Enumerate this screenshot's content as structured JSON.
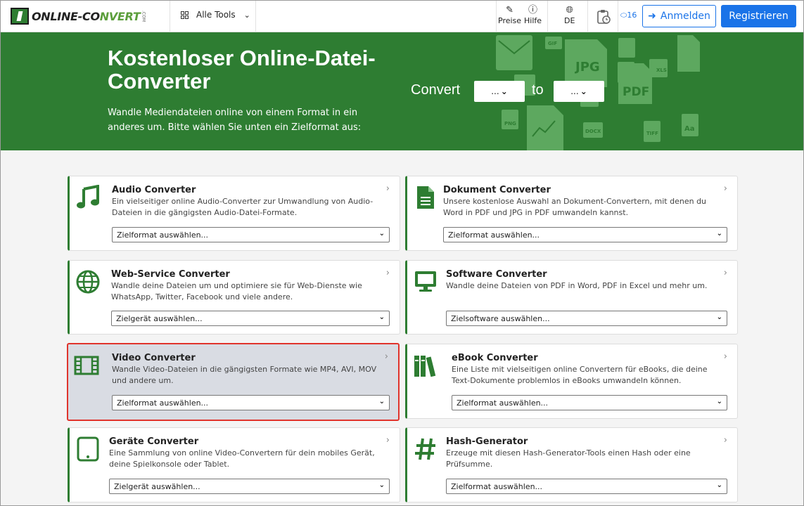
{
  "nav": {
    "logo_main": "ONLINE-CO",
    "logo_accent": "NVERT",
    "logo_suffix": ".COM",
    "all_tools": "Alle Tools",
    "prices": "Preise",
    "help": "Hilfe",
    "language": "DE",
    "tokens": "16",
    "login": "Anmelden",
    "register": "Registrieren"
  },
  "hero": {
    "title": "Kostenloser Online-Datei-Converter",
    "subtitle": "Wandle Mediendateien online von einem Format in ein anderes um. Bitte wählen Sie unten ein Zielformat aus:",
    "convert_label": "Convert",
    "to_label": "to",
    "from_value": "...",
    "to_value": "...",
    "deco_labels": [
      "GIF",
      "JPG",
      "XLS",
      "PDF",
      "PNG",
      "DOCX",
      "TIFF",
      "Aa"
    ]
  },
  "cards": [
    {
      "title": "Audio Converter",
      "desc": "Ein vielseitiger online Audio-Converter zur Umwandlung von Audio-Dateien in die gängigsten Audio-Datei-Formate.",
      "select": "Zielformat auswählen...",
      "icon": "music-note-icon"
    },
    {
      "title": "Dokument Converter",
      "desc": "Unsere kostenlose Auswahl an Dokument-Convertern, mit denen du Word in PDF und JPG in PDF umwandeln kannst.",
      "select": "Zielformat auswählen...",
      "icon": "document-icon"
    },
    {
      "title": "Web-Service Converter",
      "desc": "Wandle deine Dateien um und optimiere sie für Web-Dienste wie WhatsApp, Twitter, Facebook und viele andere.",
      "select": "Zielgerät auswählen...",
      "icon": "globe-icon"
    },
    {
      "title": "Software Converter",
      "desc": "Wandle deine Dateien von PDF in Word, PDF in Excel und mehr um.",
      "select": "Zielsoftware auswählen...",
      "icon": "monitor-icon"
    },
    {
      "title": "Video Converter",
      "desc": "Wandle Video-Dateien in die gängigsten Formate wie MP4, AVI, MOV und andere um.",
      "select": "Zielformat auswählen...",
      "icon": "film-icon"
    },
    {
      "title": "eBook Converter",
      "desc": "Eine Liste mit vielseitigen online Convertern für eBooks, die deine Text-Dokumente problemlos in eBooks umwandeln können.",
      "select": "Zielformat auswählen...",
      "icon": "books-icon"
    },
    {
      "title": "Geräte Converter",
      "desc": "Eine Sammlung von online Video-Convertern für dein mobiles Gerät, deine Spielkonsole oder Tablet.",
      "select": "Zielgerät auswählen...",
      "icon": "tablet-icon"
    },
    {
      "title": "Hash-Generator",
      "desc": "Erzeuge mit diesen Hash-Generator-Tools einen Hash oder eine Prüfsumme.",
      "select": "Zielformat auswählen...",
      "icon": "hash-icon"
    }
  ],
  "colors": {
    "brand_green": "#2e7d32",
    "accent_blue": "#1a73e8",
    "highlight_red": "#e0342c"
  }
}
